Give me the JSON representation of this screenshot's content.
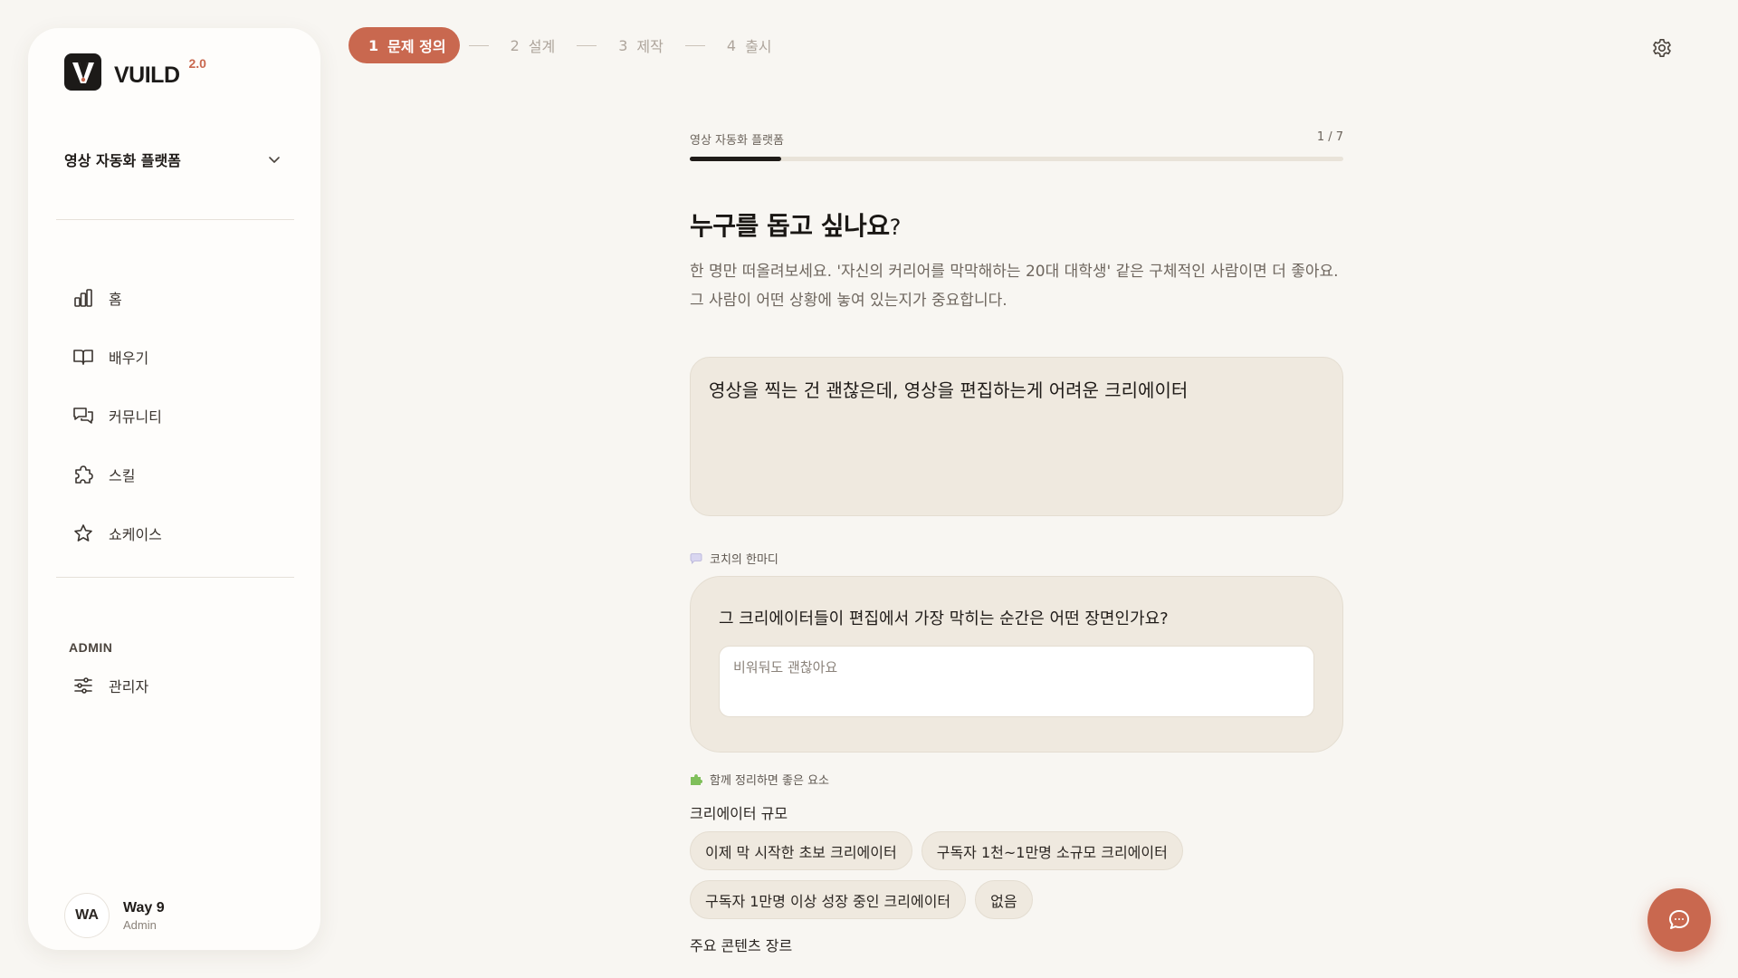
{
  "brand": {
    "name": "VUILD",
    "version": "2.0",
    "accent": "#c9684f"
  },
  "sidebar": {
    "project_select": {
      "value": "영상 자동화 플랫폼"
    },
    "nav": [
      {
        "label": "홈",
        "icon": "chart-bar-icon"
      },
      {
        "label": "배우기",
        "icon": "book-icon"
      },
      {
        "label": "커뮤니티",
        "icon": "chat-bubbles-icon"
      },
      {
        "label": "스킬",
        "icon": "puzzle-icon"
      },
      {
        "label": "쇼케이스",
        "icon": "star-icon"
      }
    ],
    "admin": {
      "title": "ADMIN",
      "items": [
        {
          "label": "관리자",
          "icon": "sliders-icon"
        }
      ]
    },
    "user": {
      "initials": "WA",
      "name": "Way 9",
      "role": "Admin"
    }
  },
  "stepper": {
    "steps": [
      {
        "num": "1",
        "label": "문제 정의",
        "active": true
      },
      {
        "num": "2",
        "label": "설계",
        "active": false
      },
      {
        "num": "3",
        "label": "제작",
        "active": false
      },
      {
        "num": "4",
        "label": "출시",
        "active": false
      }
    ]
  },
  "main": {
    "progress": {
      "label": "영상 자동화 플랫폼",
      "counter": "1 / 7",
      "fraction": 0.14
    },
    "question": {
      "text": "누구를 돕고 싶나요",
      "mark": "?"
    },
    "description": "한 명만 떠올려보세요. '자신의 커리어를 막막해하는 20대 대학생' 같은 구체적인 사람이면 더 좋아요. 그 사람이 어떤 상황에 놓여 있는지가 중요합니다.",
    "answer": "영상을 찍는 건 괜찮은데, 영상을 편집하는게 어려운 크리에이터",
    "coach": {
      "label": "코치의 한마디",
      "question": "그 크리에이터들이 편집에서 가장 막히는 순간은 어떤 장면인가요?",
      "placeholder": "비워둬도 괜찮아요"
    },
    "hints": {
      "label": "함께 정리하면 좋은 요소",
      "groups": [
        {
          "title": "크리에이터 규모",
          "chips": [
            "이제 막 시작한 초보 크리에이터",
            "구독자 1천~1만명 소규모 크리에이터",
            "구독자 1만명 이상 성장 중인 크리에이터",
            "없음"
          ]
        },
        {
          "title": "주요 콘텐츠 장르",
          "chips": []
        }
      ]
    }
  }
}
